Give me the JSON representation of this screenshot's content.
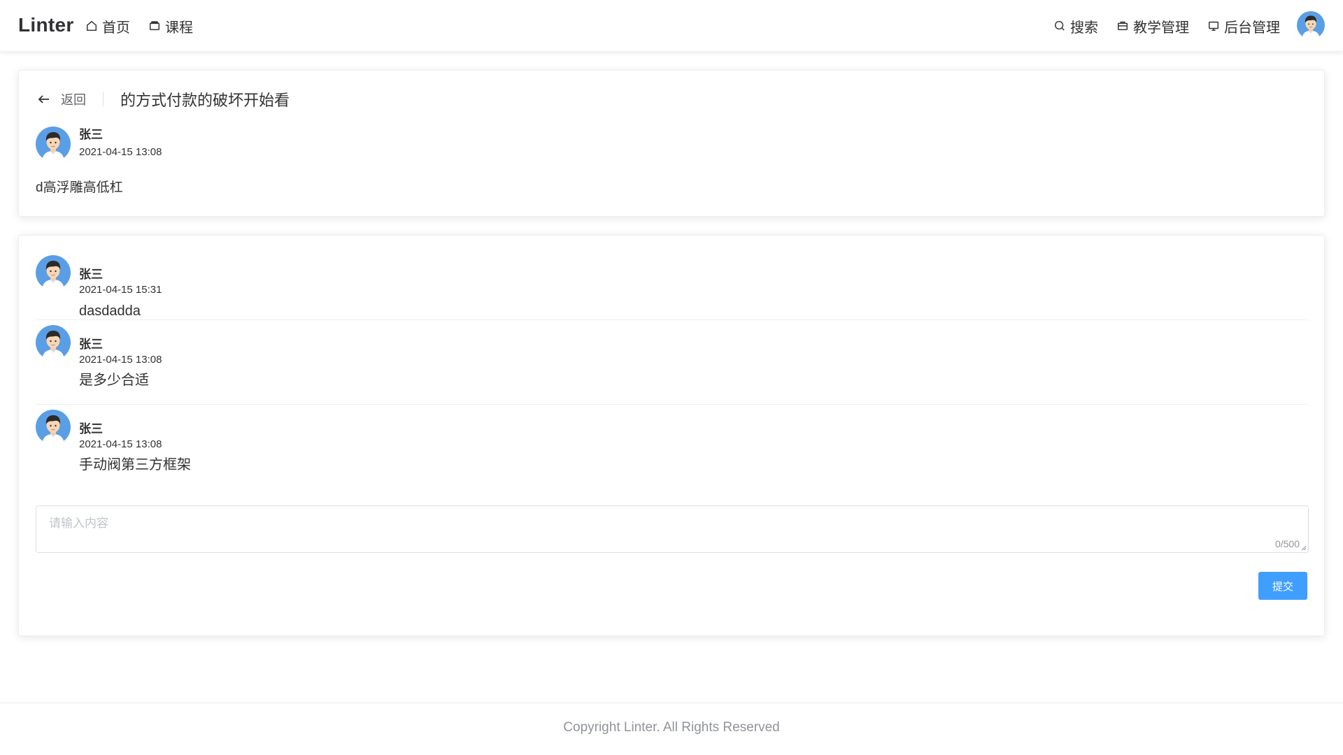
{
  "header": {
    "brand": "Linter",
    "nav_left": [
      {
        "label": "首页",
        "icon": "home-icon"
      },
      {
        "label": "课程",
        "icon": "course-icon"
      }
    ],
    "nav_right": [
      {
        "label": "搜索",
        "icon": "search-icon"
      },
      {
        "label": "教学管理",
        "icon": "teaching-icon"
      },
      {
        "label": "后台管理",
        "icon": "monitor-icon"
      }
    ]
  },
  "post": {
    "back_label": "返回",
    "title": "的方式付款的破坏开始看",
    "author": "张三",
    "time": "2021-04-15 13:08",
    "body": "d高浮雕高低杠"
  },
  "comments": [
    {
      "author": "张三",
      "time": "2021-04-15 15:31",
      "text": "dasdadda"
    },
    {
      "author": "张三",
      "time": "2021-04-15 13:08",
      "text": "是多少合适"
    },
    {
      "author": "张三",
      "time": "2021-04-15 13:08",
      "text": "手动阀第三方框架"
    }
  ],
  "reply": {
    "placeholder": "请输入内容",
    "value": "",
    "count": "0/500",
    "submit_label": "提交"
  },
  "footer": {
    "copyright": "Copyright Linter. All Rights Reserved"
  },
  "colors": {
    "accent": "#409eff",
    "text": "#303133",
    "muted": "#909399",
    "border": "#ebeef5"
  }
}
